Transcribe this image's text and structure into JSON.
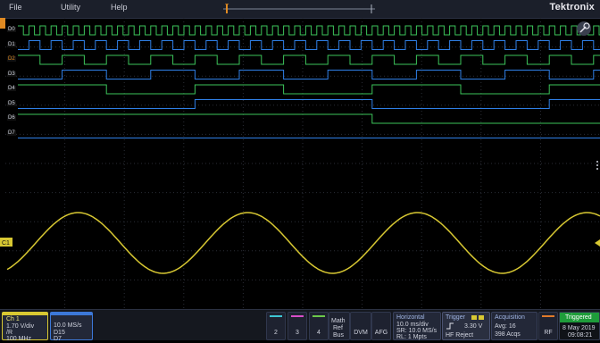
{
  "menu": [
    "File",
    "Utility",
    "Help"
  ],
  "brand": "Tektronix",
  "digital": {
    "labels": [
      "D0",
      "D1",
      "D2",
      "D3",
      "D4",
      "D5",
      "D6",
      "D7"
    ],
    "colors": [
      "#3cc45a",
      "#2f7fe6",
      "#3cc45a",
      "#2f7fe6",
      "#3cc45a",
      "#2f7fe6",
      "#3cc45a",
      "#2f7fe6"
    ]
  },
  "analog": {
    "label": "C1",
    "color": "#d8c832"
  },
  "bottom": {
    "ch1": {
      "title": "Ch 1",
      "lines": [
        "1.70 V/div",
        "/R",
        "100 MHz"
      ],
      "color": "#d8c832"
    },
    "bus": {
      "lines": [
        "10.0 MS/s",
        "D15",
        "D7"
      ],
      "color": "#3c78d8"
    },
    "ch_buttons": [
      {
        "label": "2",
        "color": "#3ec6d4"
      },
      {
        "label": "3",
        "color": "#d84ec8"
      },
      {
        "label": "4",
        "color": "#6cc84a"
      }
    ],
    "math": {
      "lines": [
        "Math",
        "Ref",
        "Bus"
      ]
    },
    "dvm": "DVM",
    "afg": "AFG",
    "horizontal": {
      "title": "Horizontal",
      "lines": [
        "10.0 ms/div",
        "SR: 10.0 MS/s",
        "RL: 1 Mpts"
      ]
    },
    "trigger": {
      "title": "Trigger",
      "level": "3.30 V",
      "mode": "HF Reject"
    },
    "acquisition": {
      "title": "Acquisition",
      "lines": [
        "Avg: 16",
        "398 Acqs"
      ]
    },
    "rf": "RF",
    "status": {
      "state": "Triggered",
      "date": "8 May 2019",
      "time": "09:08:21"
    }
  }
}
